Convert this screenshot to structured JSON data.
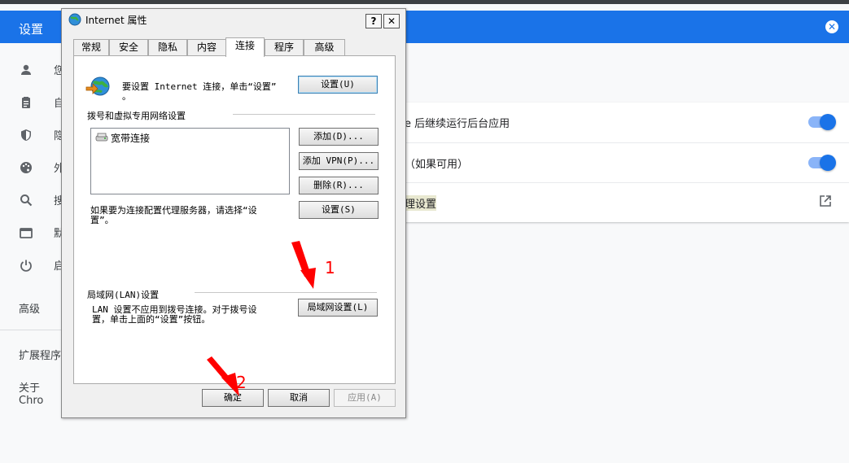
{
  "chrome": {
    "header_title": "设置",
    "close_icon": "close-icon",
    "nav_icons": [
      "person-icon",
      "clipboard-icon",
      "shield-icon",
      "palette-icon",
      "search-icon",
      "browser-icon",
      "power-icon"
    ],
    "nav_clipped": [
      "您",
      "自",
      "隐",
      "外",
      "搜",
      "默",
      "启"
    ],
    "advanced_label": "高级",
    "extensions_label": "扩展程序",
    "about_label": "关于 Chro",
    "rows": [
      {
        "text": "e 后继续运行后台应用",
        "toggle": true
      },
      {
        "text": "（如果可用）",
        "toggle": true
      },
      {
        "text": "理设置",
        "toggle": false
      }
    ],
    "accent": "#1a73e8"
  },
  "dialog": {
    "title": "Internet 属性",
    "help_btn": "?",
    "close_btn": "✕",
    "tabs": [
      "常规",
      "安全",
      "隐私",
      "内容",
      "连接",
      "程序",
      "高级"
    ],
    "active_tab": "连接",
    "setup_text_line1": "要设置 Internet 连接，单击“设置”",
    "setup_text_line2": "。",
    "setup_button": "设置(U)",
    "dialup_group": "拨号和虚拟专用网络设置",
    "connections": [
      "宽带连接"
    ],
    "add_button": "添加(D)...",
    "add_vpn_button": "添加 VPN(P)...",
    "remove_button": "删除(R)...",
    "settings_button": "设置(S)",
    "proxy_text_line1": "如果要为连接配置代理服务器，请选择“设",
    "proxy_text_line2": "置”。",
    "lan_group": "局域网(LAN)设置",
    "lan_text_line1": "LAN 设置不应用到拨号连接。对于拨号设",
    "lan_text_line2": "置，单击上面的“设置”按钮。",
    "lan_button": "局域网设置(L)",
    "ok_button": "确定",
    "cancel_button": "取消",
    "apply_button": "应用(A)"
  },
  "annotations": {
    "marker_1": "1",
    "marker_2": "2"
  }
}
